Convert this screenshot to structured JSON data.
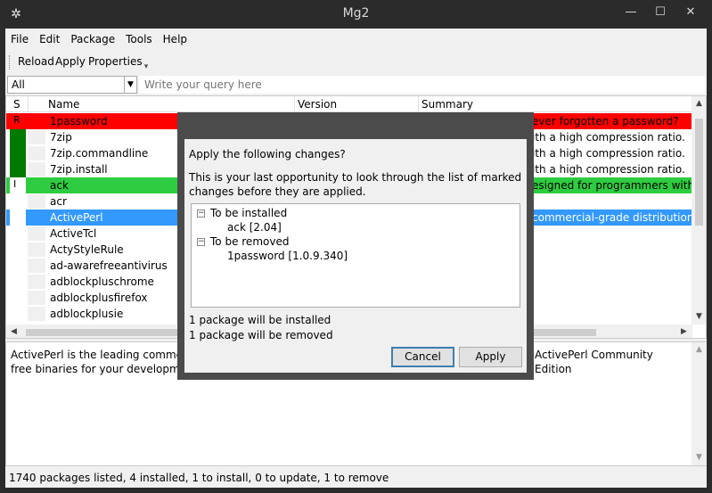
{
  "window": {
    "title": "Mg2",
    "icon": "gear-snowflake-icon",
    "controls": [
      "minimize-icon",
      "maximize-icon",
      "close-icon"
    ]
  },
  "menu": [
    "File",
    "Edit",
    "Package",
    "Tools",
    "Help"
  ],
  "toolbar": {
    "reload_label": "Reload",
    "apply_label": "Apply",
    "properties_label": "Properties"
  },
  "filter": {
    "selected": "All",
    "query_placeholder": "Write your query here"
  },
  "grid": {
    "columns": [
      "S",
      "Name",
      "Version",
      "Summary"
    ],
    "rows": [
      {
        "status": "R",
        "name": "1password",
        "summary": "ever forgotten a password?",
        "bg": "#ff0000",
        "status_color": "#ff0000"
      },
      {
        "status": "",
        "name": "7zip",
        "summary": "ith a high compression ratio.",
        "bg": "#ffffff",
        "status_color": "#007a00"
      },
      {
        "status": "",
        "name": "7zip.commandline",
        "summary": "ith a high compression ratio.",
        "bg": "#ffffff",
        "status_color": "#007a00"
      },
      {
        "status": "",
        "name": "7zip.install",
        "summary": "ith a high compression ratio.",
        "bg": "#ffffff",
        "status_color": "#007a00"
      },
      {
        "status": "I",
        "name": "ack",
        "summary": "esigned for programmers with la",
        "bg": "#2ecc40",
        "status_color": "#ffffff"
      },
      {
        "status": "",
        "name": "acr",
        "summary": "",
        "bg": "#ffffff",
        "status_color": "#ffffff"
      },
      {
        "status": "",
        "name": "ActivePerl",
        "summary": "commercial-grade distribution c",
        "bg": "#3399ff",
        "status_color": "#ffffff"
      },
      {
        "status": "",
        "name": "ActiveTcl",
        "summary": "",
        "bg": "#ffffff",
        "status_color": "#ffffff"
      },
      {
        "status": "",
        "name": "ActyStyleRule",
        "summary": "",
        "bg": "#ffffff",
        "status_color": "#ffffff"
      },
      {
        "status": "",
        "name": "ad-awarefreeantivirus",
        "summary": "",
        "bg": "#ffffff",
        "status_color": "#ffffff"
      },
      {
        "status": "",
        "name": "adblockpluschrome",
        "summary": "",
        "bg": "#ffffff",
        "status_color": "#ffffff"
      },
      {
        "status": "",
        "name": "adblockplusfirefox",
        "summary": "",
        "bg": "#ffffff",
        "status_color": "#ffffff"
      },
      {
        "status": "",
        "name": "adblockplusie",
        "summary": "",
        "bg": "#ffffff",
        "status_color": "#ffffff"
      }
    ]
  },
  "details": {
    "line1_left": "ActivePerl is the leading commercia",
    "line1_right": "ActivePerl Community Edition",
    "line2": "free binaries for your development"
  },
  "status": "1740 packages listed, 4 installed, 1 to install, 0 to update, 1 to remove",
  "dialog": {
    "heading": "Apply the following changes?",
    "message_line1": "This is your last opportunity to look through the list of marked",
    "message_line2": "changes before they are applied.",
    "install_group": "To be installed",
    "install_item": "ack [2.04]",
    "remove_group": "To be removed",
    "remove_item": "1password [1.0.9.340]",
    "summary_install": "1 package will be installed",
    "summary_remove": "1 package will be removed",
    "cancel_label": "Cancel",
    "apply_label": "Apply"
  },
  "colors": {
    "title_bg": "#2b2b2b",
    "remove_row": "#ff0000",
    "install_row": "#2ecc40",
    "selected_row": "#3399ff",
    "installed_marker": "#007a00"
  }
}
